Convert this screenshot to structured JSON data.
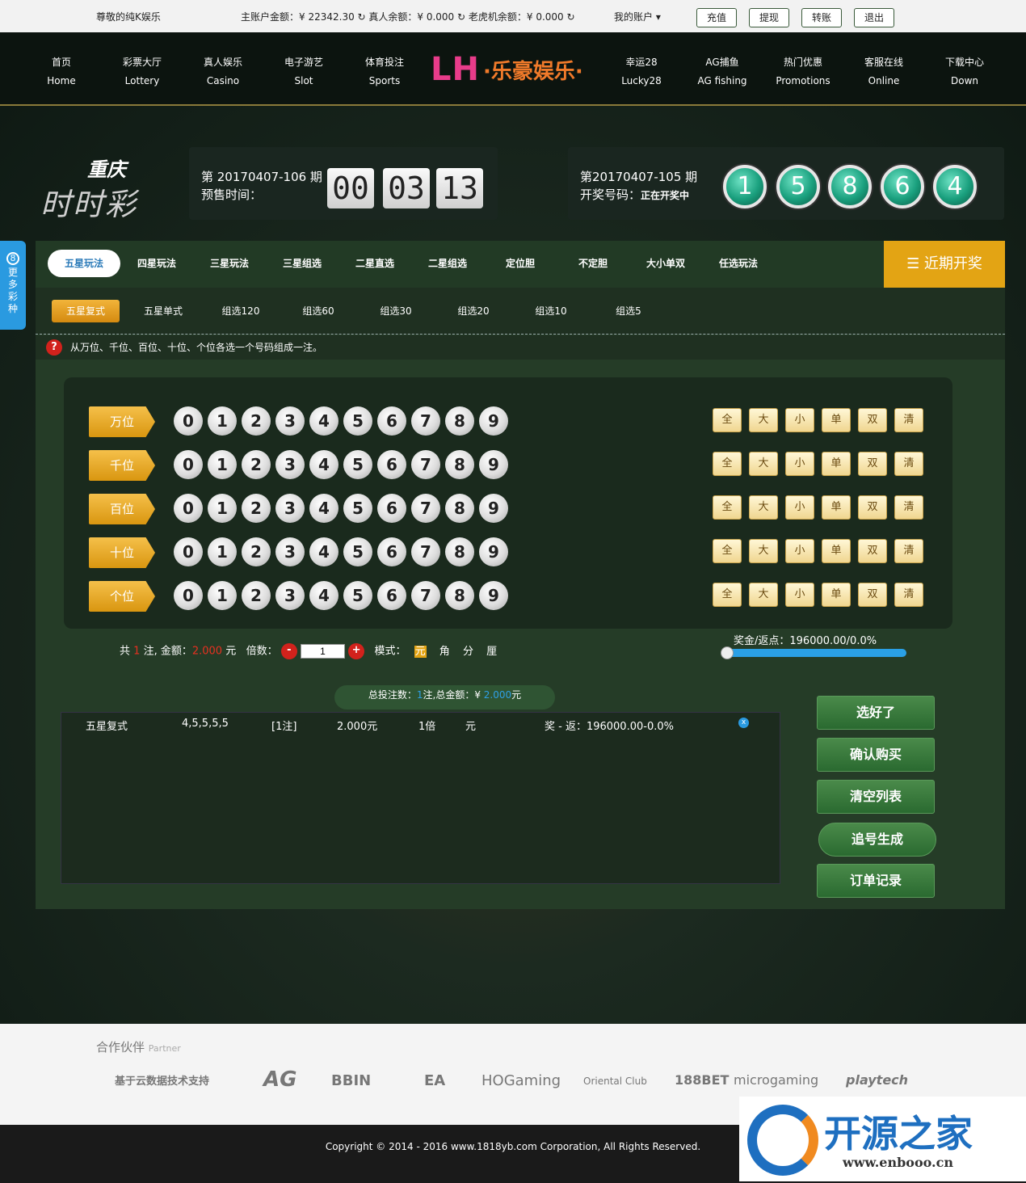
{
  "topbar": {
    "greeting": "尊敬的纯K娱乐",
    "balances": "主账户金额：¥ 22342.30 ↻ 真人余额：¥ 0.000 ↻ 老虎机余额：¥ 0.000 ↻",
    "account": "我的账户 ▾",
    "buttons": [
      "充值",
      "提现",
      "转账",
      "退出"
    ]
  },
  "nav": {
    "items": [
      {
        "cn": "首页",
        "en": "Home"
      },
      {
        "cn": "彩票大厅",
        "en": "Lottery"
      },
      {
        "cn": "真人娱乐",
        "en": "Casino"
      },
      {
        "cn": "电子游艺",
        "en": "Slot"
      },
      {
        "cn": "体育投注",
        "en": "Sports"
      },
      {
        "cn": "幸运28",
        "en": "Lucky28"
      },
      {
        "cn": "AG捕鱼",
        "en": "AG fishing"
      },
      {
        "cn": "热门优惠",
        "en": "Promotions"
      },
      {
        "cn": "客服在线",
        "en": "Online"
      },
      {
        "cn": "下载中心",
        "en": "Down"
      }
    ],
    "logo_lh": "LH",
    "logo_cn": "·乐豪娱乐·"
  },
  "brand": {
    "line1": "重庆",
    "line2": "时时彩"
  },
  "current": {
    "issue": "第 20170407-106 期",
    "label": "预售时间：",
    "digits": [
      "00",
      "03",
      "13"
    ]
  },
  "last": {
    "issue": "第20170407-105 期",
    "label": "开奖号码：",
    "status": "正在开奖中",
    "balls": [
      "1",
      "5",
      "8",
      "6",
      "4"
    ]
  },
  "side_tab": {
    "num": "8",
    "text": "更多彩种"
  },
  "tabs": [
    "五星玩法",
    "四星玩法",
    "三星玩法",
    "三星组选",
    "二星直选",
    "二星组选",
    "定位胆",
    "不定胆",
    "大小单双",
    "任选玩法"
  ],
  "recent": "近期开奖",
  "subtabs": [
    "五星复式",
    "五星单式",
    "组选120",
    "组选60",
    "组选30",
    "组选20",
    "组选10",
    "组选5"
  ],
  "hint": {
    "icon": "?",
    "text": "从万位、千位、百位、十位、个位各选一个号码组成一注。"
  },
  "positions": [
    "万位",
    "千位",
    "百位",
    "十位",
    "个位"
  ],
  "numbers": [
    "0",
    "1",
    "2",
    "3",
    "4",
    "5",
    "6",
    "7",
    "8",
    "9"
  ],
  "quick": [
    "全",
    "大",
    "小",
    "单",
    "双",
    "清"
  ],
  "bet": {
    "prefix": "共",
    "count": "1",
    "mid": "注, 金额：",
    "amount": "2.000",
    "unit": "元",
    "multiple_label": "倍数：",
    "multiple": "1",
    "mode_label": "模式：",
    "modes": [
      "元",
      "角",
      "分",
      "厘"
    ]
  },
  "prize": {
    "label": "奖金/返点：196000.00/0.0%",
    "fraction": 0
  },
  "summary": {
    "a": "总投注数：",
    "count": "1",
    "b": "注,总金额：¥ ",
    "amount": "2.000",
    "c": "元"
  },
  "order": {
    "type": "五星复式",
    "numbers": "4,5,5,5,5",
    "count": "[1注]",
    "amount": "2.000元",
    "multiple": "1倍",
    "unit": "元",
    "prize": "奖 - 返：196000.00-0.0%"
  },
  "actions": [
    "选好了",
    "确认购买",
    "清空列表",
    "追号生成",
    "订单记录"
  ],
  "partners": {
    "title": "合作伙伴",
    "title_en": "Partner",
    "logos": [
      "基于云数据技术支持",
      "AG",
      "BBIN",
      "EA",
      "HOGaming",
      "Oriental Club",
      "188BET",
      "microgaming",
      "playtech"
    ]
  },
  "footer": "Copyright © 2014 - 2016 www.1818yb.com Corporation, All Rights Reserved.",
  "watermark": {
    "t1": "开源之家",
    "t2": "www.enbooo.cn"
  }
}
